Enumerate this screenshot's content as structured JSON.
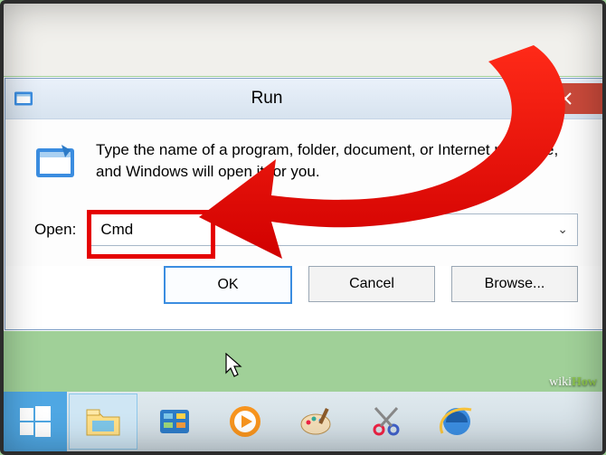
{
  "dialog": {
    "title": "Run",
    "description": "Type the name of a program, folder, document, or Internet resource, and Windows will open it for you.",
    "open_label": "Open:",
    "open_value": "Cmd",
    "ok_label": "OK",
    "cancel_label": "Cancel",
    "browse_label": "Browse..."
  },
  "watermark": "wikiHow",
  "taskbar": {
    "start": "Start",
    "items": [
      "File Explorer",
      "Control Panel",
      "Windows Media Player",
      "Paint",
      "Snipping Tool",
      "Internet Explorer"
    ]
  }
}
